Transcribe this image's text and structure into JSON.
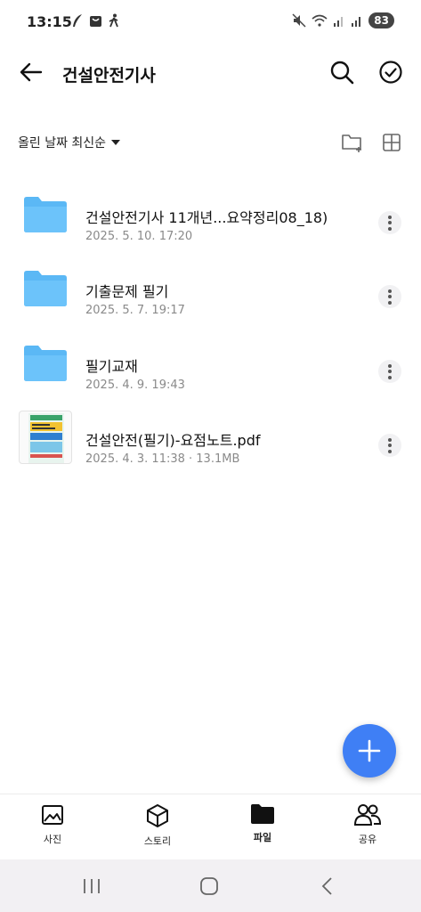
{
  "status_bar": {
    "time": "13:15",
    "battery": "83"
  },
  "header": {
    "title": "건설안전기사",
    "back_icon": "arrow-left-icon",
    "search_icon": "search-icon",
    "select_icon": "check-circle-icon"
  },
  "sort": {
    "label": "올린 날짜 최신순"
  },
  "files": [
    {
      "type": "folder",
      "name": "건설안전기사 11개년...요약정리08_18)",
      "meta": "2025. 5. 10. 17:20"
    },
    {
      "type": "folder",
      "name": "기출문제 필기",
      "meta": "2025. 5. 7. 19:17"
    },
    {
      "type": "folder",
      "name": "필기교재",
      "meta": "2025. 4. 9. 19:43"
    },
    {
      "type": "pdf",
      "name": "건설안전(필기)-요점노트.pdf",
      "meta": "2025. 4. 3. 11:38 · 13.1MB"
    }
  ],
  "bottom_nav": [
    {
      "label": "사진",
      "icon": "photo-icon",
      "active": false
    },
    {
      "label": "스토리",
      "icon": "cube-icon",
      "active": false
    },
    {
      "label": "파일",
      "icon": "folder-icon",
      "active": true
    },
    {
      "label": "공유",
      "icon": "people-icon",
      "active": false
    }
  ],
  "colors": {
    "folder": "#5bb8f5",
    "fab": "#3f7ff5",
    "meta_text": "#8a8a8a"
  }
}
